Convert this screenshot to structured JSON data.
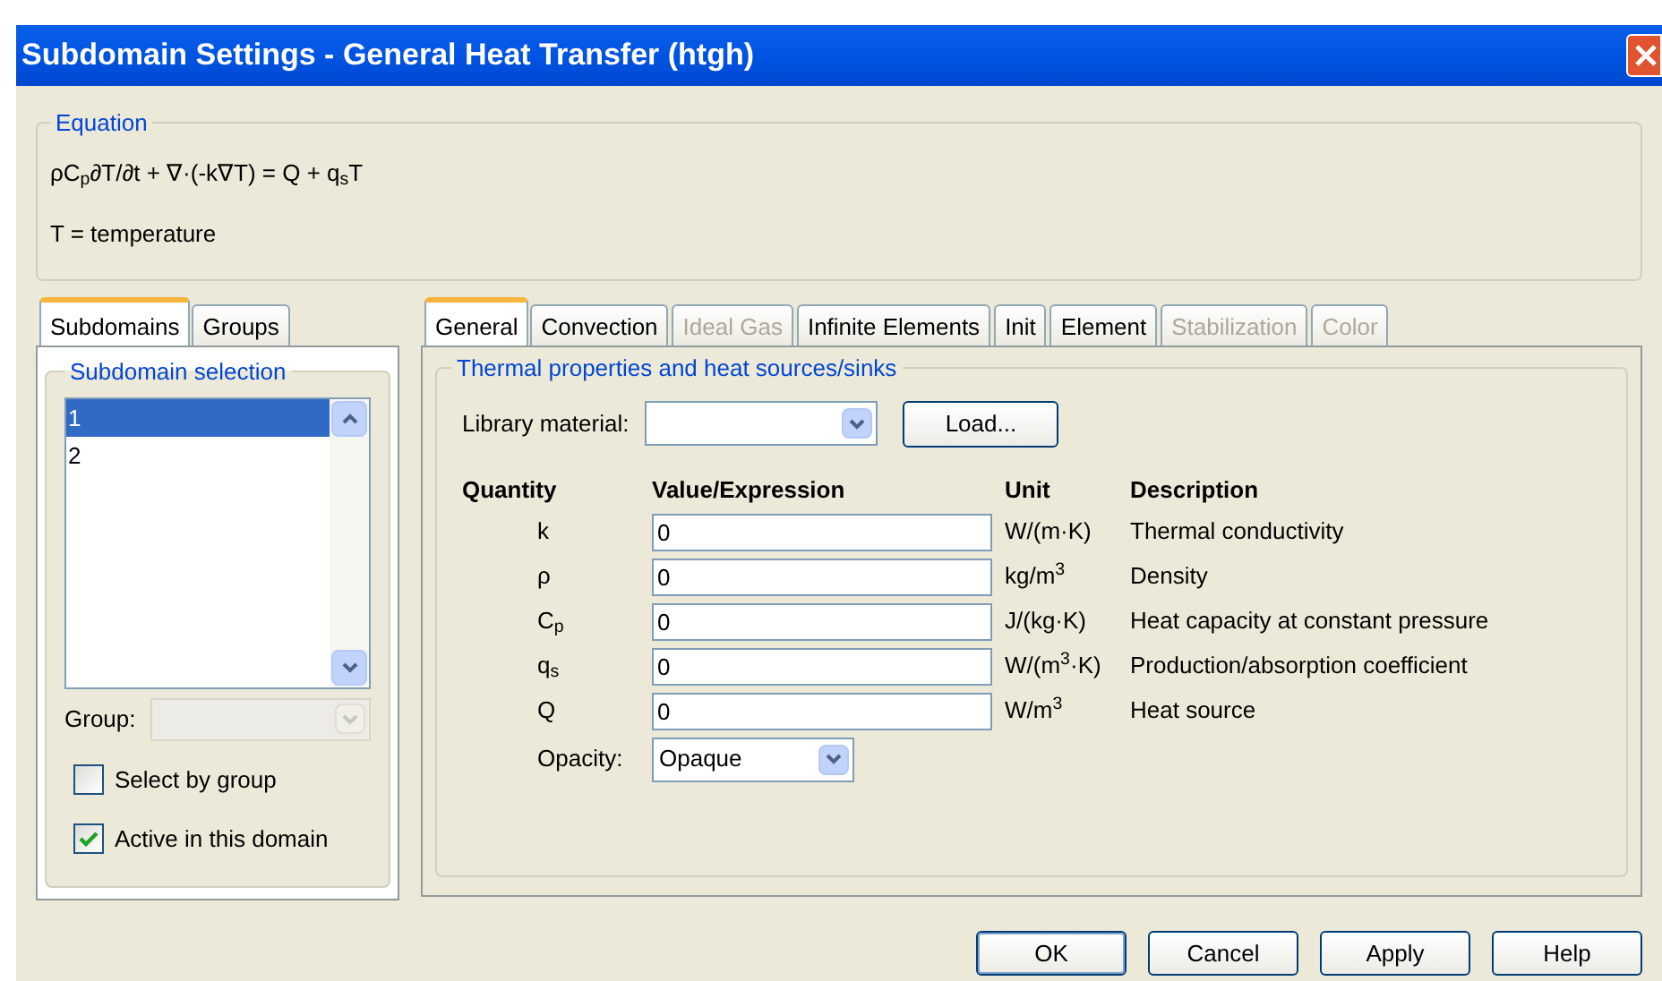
{
  "window": {
    "title": "Subdomain Settings - General Heat Transfer (htgh)"
  },
  "equation": {
    "title": "Equation",
    "formula": "ρC$_{p}$∂T/∂t + ∇·(-k∇T) = Q + q$_{s}$T",
    "definition": "T = temperature"
  },
  "left_tabs": [
    {
      "label": "Subdomains",
      "selected": true
    },
    {
      "label": "Groups",
      "selected": false
    }
  ],
  "subdomain_selection": {
    "title": "Subdomain selection",
    "items": [
      {
        "label": "1",
        "selected": true
      },
      {
        "label": "2",
        "selected": false
      }
    ],
    "group": {
      "label": "Group:",
      "disabled": true
    },
    "checkboxes": [
      {
        "label": "Select by group",
        "checked": false
      },
      {
        "label": "Active in this domain",
        "checked": true
      }
    ]
  },
  "right_tabs": [
    {
      "label": "General",
      "selected": true,
      "disabled": false
    },
    {
      "label": "Convection",
      "selected": false,
      "disabled": false
    },
    {
      "label": "Ideal Gas",
      "selected": false,
      "disabled": true
    },
    {
      "label": "Infinite Elements",
      "selected": false,
      "disabled": false
    },
    {
      "label": "Init",
      "selected": false,
      "disabled": false
    },
    {
      "label": "Element",
      "selected": false,
      "disabled": false
    },
    {
      "label": "Stabilization",
      "selected": false,
      "disabled": true
    },
    {
      "label": "Color",
      "selected": false,
      "disabled": true
    }
  ],
  "properties": {
    "title": "Thermal properties and heat sources/sinks",
    "library_label": "Library material:",
    "load_button": "Load...",
    "columns": [
      "Quantity",
      "Value/Expression",
      "Unit",
      "Description"
    ],
    "rows": [
      {
        "quantity": "k",
        "value": "0",
        "unit": "W/(m·K)",
        "description": "Thermal conductivity"
      },
      {
        "quantity": "ρ",
        "value": "0",
        "unit": "kg/m$^{3}$",
        "description": "Density"
      },
      {
        "quantity": "C$_{p}$",
        "value": "0",
        "unit": "J/(kg·K)",
        "description": "Heat capacity at constant pressure"
      },
      {
        "quantity": "q$_{s}$",
        "value": "0",
        "unit": "W/(m$^{3}$·K)",
        "description": "Production/absorption coefficient"
      },
      {
        "quantity": "Q",
        "value": "0",
        "unit": "W/m$^{3}$",
        "description": "Heat source"
      }
    ],
    "opacity_label": "Opacity:",
    "opacity_value": "Opaque"
  },
  "buttons": [
    "OK",
    "Cancel",
    "Apply",
    "Help"
  ]
}
